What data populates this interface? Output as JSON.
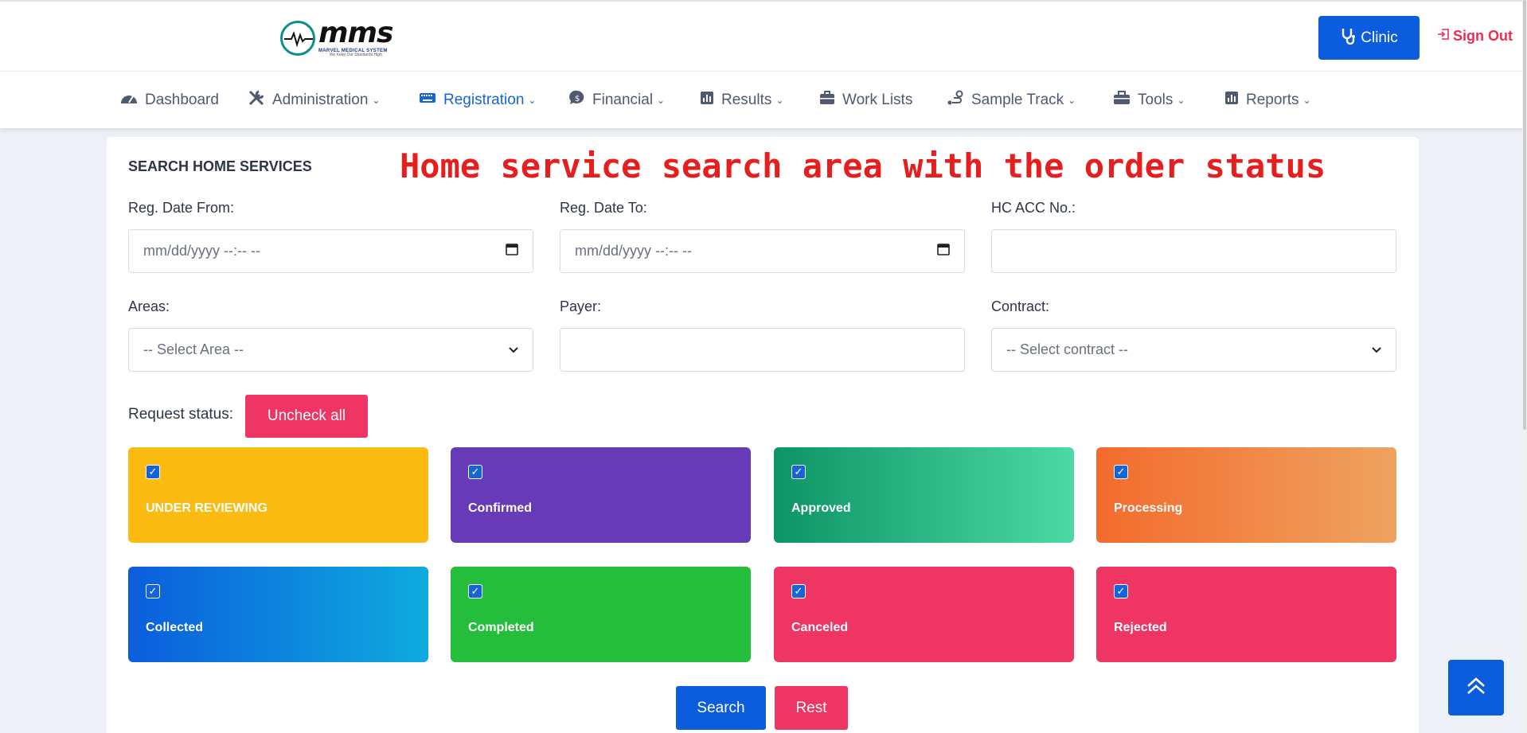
{
  "header": {
    "logo_text": "mms",
    "logo_subtitle": "MARVEL MEDICAL SYSTEM",
    "logo_tagline": "We Keep Our Standards High",
    "clinic_label": "Clinic",
    "signout_label": "Sign Out"
  },
  "nav": {
    "items": [
      {
        "label": "Dashboard",
        "icon": "dashboard-gauge-icon"
      },
      {
        "label": "Administration",
        "icon": "tools-icon",
        "dropdown": true
      },
      {
        "label": "Registration",
        "icon": "keyboard-icon",
        "dropdown": true,
        "active": true
      },
      {
        "label": "Financial",
        "icon": "money-chat-icon",
        "dropdown": true
      },
      {
        "label": "Results",
        "icon": "chart-icon",
        "dropdown": true
      },
      {
        "label": "Work Lists",
        "icon": "briefcase-icon"
      },
      {
        "label": "Sample Track",
        "icon": "route-icon",
        "dropdown": true
      },
      {
        "label": "Tools",
        "icon": "toolbox-icon",
        "dropdown": true
      },
      {
        "label": "Reports",
        "icon": "chart-icon",
        "dropdown": true
      }
    ]
  },
  "search": {
    "title": "SEARCH HOME SERVICES",
    "annotation": "Home service search area with the order status",
    "reg_date_from_label": "Reg. Date From:",
    "reg_date_from_placeholder": "mm/dd/yyyy --:-- --",
    "reg_date_to_label": "Reg. Date To:",
    "reg_date_to_placeholder": "mm/dd/yyyy --:-- --",
    "hc_acc_label": "HC ACC No.:",
    "hc_acc_value": "",
    "areas_label": "Areas:",
    "areas_selected": "-- Select Area --",
    "payer_label": "Payer:",
    "payer_value": "",
    "contract_label": "Contract:",
    "contract_selected": "-- Select contract --",
    "request_status_label": "Request status:",
    "uncheck_all_label": "Uncheck all",
    "search_label": "Search",
    "rest_label": "Rest"
  },
  "statuses": [
    {
      "name": "UNDER REVIEWING",
      "checked": true,
      "color": "#fbbb10"
    },
    {
      "name": "Confirmed",
      "checked": true,
      "color": "#673ab7"
    },
    {
      "name": "Approved",
      "checked": true,
      "color": "#0d9466"
    },
    {
      "name": "Processing",
      "checked": true,
      "color": "#f36b2c"
    },
    {
      "name": "Collected",
      "checked": true,
      "color": "#0b5ddd"
    },
    {
      "name": "Completed",
      "checked": true,
      "color": "#24bd3c"
    },
    {
      "name": "Canceled",
      "checked": true,
      "color": "#ee3563"
    },
    {
      "name": "Rejected",
      "checked": true,
      "color": "#ee3563"
    }
  ],
  "colors": {
    "primary": "#0b5ddd",
    "danger": "#ee3563",
    "annotation": "#e61e1e"
  }
}
